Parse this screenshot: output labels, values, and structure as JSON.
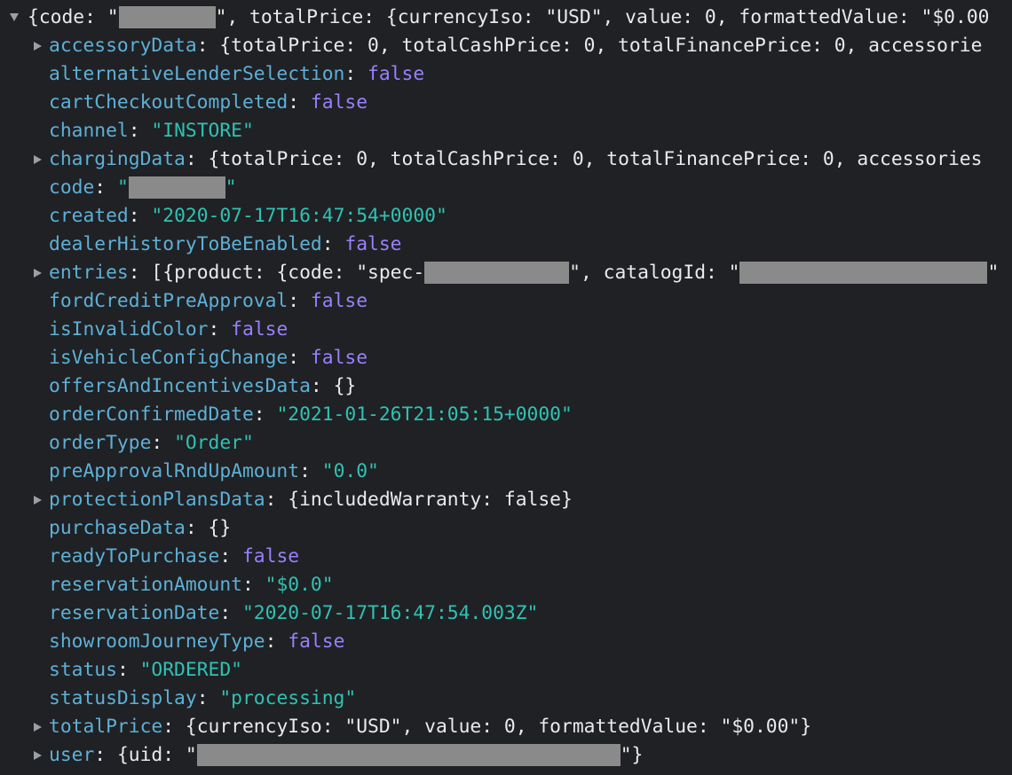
{
  "root": {
    "preview_start": "{code: \"",
    "preview_end": "\", totalPrice: {currencyIso: \"USD\", value: 0, formattedValue: \"$0.00"
  },
  "properties": {
    "accessoryData": {
      "key": "accessoryData",
      "preview": "{totalPrice: 0, totalCashPrice: 0, totalFinancePrice: 0, accessorie"
    },
    "alternativeLenderSelection": {
      "key": "alternativeLenderSelection",
      "value": "false"
    },
    "cartCheckoutCompleted": {
      "key": "cartCheckoutCompleted",
      "value": "false"
    },
    "channel": {
      "key": "channel",
      "value": "\"INSTORE\""
    },
    "chargingData": {
      "key": "chargingData",
      "preview": "{totalPrice: 0, totalCashPrice: 0, totalFinancePrice: 0, accessories"
    },
    "code": {
      "key": "code",
      "value_start": "\"",
      "value_end": "\""
    },
    "created": {
      "key": "created",
      "value": "\"2020-07-17T16:47:54+0000\""
    },
    "dealerHistoryToBeEnabled": {
      "key": "dealerHistoryToBeEnabled",
      "value": "false"
    },
    "entries": {
      "key": "entries",
      "preview_start": "[{product: {code: \"spec-",
      "preview_mid": "\", catalogId: \"",
      "preview_end": "\""
    },
    "fordCreditPreApproval": {
      "key": "fordCreditPreApproval",
      "value": "false"
    },
    "isInvalidColor": {
      "key": "isInvalidColor",
      "value": "false"
    },
    "isVehicleConfigChange": {
      "key": "isVehicleConfigChange",
      "value": "false"
    },
    "offersAndIncentivesData": {
      "key": "offersAndIncentivesData",
      "value": "{}"
    },
    "orderConfirmedDate": {
      "key": "orderConfirmedDate",
      "value": "\"2021-01-26T21:05:15+0000\""
    },
    "orderType": {
      "key": "orderType",
      "value": "\"Order\""
    },
    "preApprovalRndUpAmount": {
      "key": "preApprovalRndUpAmount",
      "value": "\"0.0\""
    },
    "protectionPlansData": {
      "key": "protectionPlansData",
      "preview": "{includedWarranty: false}"
    },
    "purchaseData": {
      "key": "purchaseData",
      "value": "{}"
    },
    "readyToPurchase": {
      "key": "readyToPurchase",
      "value": "false"
    },
    "reservationAmount": {
      "key": "reservationAmount",
      "value": "\"$0.0\""
    },
    "reservationDate": {
      "key": "reservationDate",
      "value": "\"2020-07-17T16:47:54.003Z\""
    },
    "showroomJourneyType": {
      "key": "showroomJourneyType",
      "value": "false"
    },
    "status": {
      "key": "status",
      "value": "\"ORDERED\""
    },
    "statusDisplay": {
      "key": "statusDisplay",
      "value": "\"processing\""
    },
    "totalPrice": {
      "key": "totalPrice",
      "preview": "{currencyIso: \"USD\", value: 0, formattedValue: \"$0.00\"}"
    },
    "user": {
      "key": "user",
      "preview_start": "{uid: \"",
      "preview_end": "\"}"
    }
  },
  "separator": ": ",
  "colors": {
    "background": "#202124",
    "key": "#5db0d7",
    "string": "#2fc2b4",
    "boolean": "#9980ff",
    "text": "#e8eaed",
    "redaction": "#8a8a8a",
    "disclosure_triangle": "#9aa0a6"
  },
  "icons": {
    "expanded": "disclosure-triangle-down-icon",
    "collapsed": "disclosure-triangle-right-icon"
  }
}
